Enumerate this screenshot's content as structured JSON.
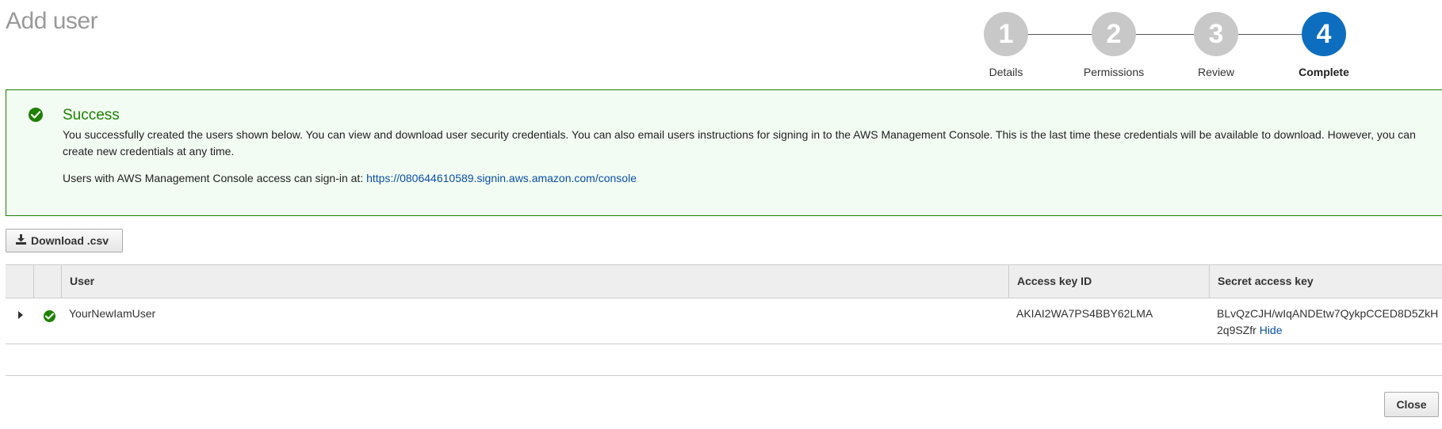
{
  "page": {
    "title": "Add user"
  },
  "stepper": {
    "steps": [
      {
        "number": "1",
        "label": "Details"
      },
      {
        "number": "2",
        "label": "Permissions"
      },
      {
        "number": "3",
        "label": "Review"
      },
      {
        "number": "4",
        "label": "Complete"
      }
    ],
    "active_step": 4
  },
  "alert": {
    "title": "Success",
    "message": "You successfully created the users shown below. You can view and download user security credentials. You can also email users instructions for signing in to the AWS Management Console. This is the last time these credentials will be available to download. However, you can create new credentials at any time.",
    "signin_prefix": "Users with AWS Management Console access can sign-in at: ",
    "signin_url": "https://080644610589.signin.aws.amazon.com/console",
    "icon": "check-circle-icon"
  },
  "toolbar": {
    "download_label": "Download .csv",
    "download_icon": "download-icon"
  },
  "table": {
    "headers": {
      "user": "User",
      "access_key_id": "Access key ID",
      "secret_access_key": "Secret access key"
    },
    "rows": [
      {
        "user": "YourNewIamUser",
        "access_key_id": "AKIAI2WA7PS4BBY62LMA",
        "secret_line1": "BLvQzCJH/wIqANDEtw7QykpCCED8D5ZkH",
        "secret_line2": "2q9SZfr",
        "hide_label": "Hide",
        "status_icon": "check-circle-icon"
      }
    ]
  },
  "footer": {
    "close_label": "Close"
  },
  "colors": {
    "success": "#1d8102",
    "success_bg": "#f2fcf3",
    "active_step": "#0d6ebf",
    "inactive_step": "#c8c8c8",
    "link": "#0b4fa7"
  }
}
